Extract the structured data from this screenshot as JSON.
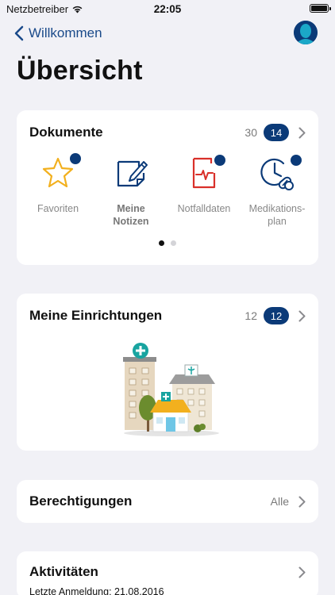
{
  "status": {
    "carrier": "Netzbetreiber",
    "time": "22:05"
  },
  "nav": {
    "back_label": "Willkommen"
  },
  "page_title": "Übersicht",
  "documents": {
    "title": "Dokumente",
    "count": "30",
    "badge": "14",
    "tiles": [
      {
        "icon": "star-icon",
        "label": "Favoriten",
        "has_dot": true
      },
      {
        "icon": "notes-icon",
        "label": "Meine\nNotizen",
        "has_dot": false
      },
      {
        "icon": "emergency-data-icon",
        "label": "Notfalldaten",
        "has_dot": true
      },
      {
        "icon": "medication-plan-icon",
        "label": "Medikations-\nplan",
        "has_dot": true
      }
    ],
    "page_indicator": {
      "pages": 2,
      "current": 1
    }
  },
  "facilities": {
    "title": "Meine Einrichtungen",
    "count": "12",
    "badge": "12"
  },
  "permissions": {
    "title": "Berechtigungen",
    "value": "Alle"
  },
  "activities": {
    "title": "Aktivitäten",
    "last_login": "Letzte Anmeldung: 21.08.2016"
  },
  "colors": {
    "accent": "#0b3a78",
    "star": "#f2b01e",
    "emergency": "#d9302a",
    "background": "#f1f1f6"
  }
}
